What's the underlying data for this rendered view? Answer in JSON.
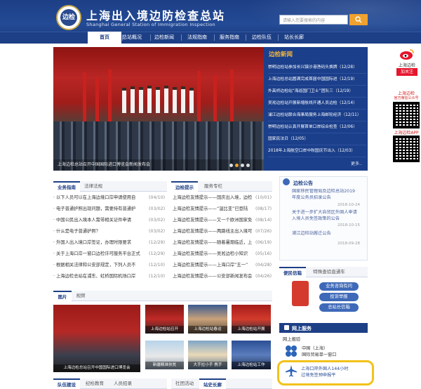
{
  "header": {
    "title": "上海出入境边防检查总站",
    "subtitle": "Shanghai General Station of Immigration Inspection",
    "search_placeholder": "请输入您要搜索的内容",
    "logo_text": "边检"
  },
  "nav": [
    "首页",
    "总站概况",
    "边检新闻",
    "法规指南",
    "服务指南",
    "边检队伍",
    "站长长廊"
  ],
  "slider": {
    "caption": "上海边检总站召开中国国际进口博览会新闻发布会",
    "dots": 4
  },
  "news": {
    "title": "边检新闻",
    "more": "更多..",
    "items": [
      {
        "text": "崇明边检站参加长兴镇沙港渔码头换牌",
        "date": "（12/28）"
      },
      {
        "text": "上海边检总站圆满完成首届中国国际进",
        "date": "（12/19）"
      },
      {
        "text": "外高桥边检站“海巡国门卫士”团队三",
        "date": "（12/19）"
      },
      {
        "text": "吴淞边检站开展新增航线开通人员边检",
        "date": "（12/14）"
      },
      {
        "text": "浦江边检站联合海事局服务上海邮轮经济",
        "date": "（12/11）"
      },
      {
        "text": "崇明边检站认真开展首单口岸综合检查",
        "date": "（12/06）"
      },
      {
        "text": "国家民法日（12/05）",
        "date": ""
      },
      {
        "text": "2018年上海航空口岸中秋国庆节出入",
        "date": "（12/03）"
      }
    ]
  },
  "right_rail": {
    "weibo_label": "上海边检",
    "follow": "加关注",
    "app_label1": "上海边检",
    "app_label2": "官方微信公众号",
    "app_label3": "上海边检APP"
  },
  "guide": {
    "tabs": [
      "业务指南",
      "法律法规"
    ],
    "items": [
      {
        "text": "· 以下人员可以在上海边境口岸申请使用自",
        "date": "(04/10)"
      },
      {
        "text": "· 电子普通护照出现问题，需要持有普通护",
        "date": "(03/02)"
      },
      {
        "text": "· 中国公民出入境本人需带相关证件申请",
        "date": "(03/02)"
      },
      {
        "text": "· 什么是电子普通护照？",
        "date": "(03/02)"
      },
      {
        "text": "· 外国人出入境口岸签证，办理时限要求",
        "date": "(12/29)"
      },
      {
        "text": "· 关于上海口岸一窗口边检许可服务平台正式",
        "date": "(12/29)"
      },
      {
        "text": "· 根据相关法律和公安部规定，下列人员不",
        "date": "(12/10)"
      },
      {
        "text": "· 上海边检总站在浦东、虹桥国际机场口岸",
        "date": "(12/10)"
      }
    ]
  },
  "tips": {
    "tabs": [
      "边检提示",
      "服务专栏"
    ],
    "items": [
      {
        "text": "上海边检友情提示——国庆出入境，边检",
        "date": "(10/01)"
      },
      {
        "text": "上海边检友情提示——“温比亚”已登陆",
        "date": "(08/17)"
      },
      {
        "text": "上海边检友情提示——又一个欧洲国家免",
        "date": "(08/14)"
      },
      {
        "text": "上海边检友情提示——两路线主出入境可",
        "date": "(07/26)"
      },
      {
        "text": "上海边检友情提示——随着暑期临近，上",
        "date": "(06/19)"
      },
      {
        "text": "上海边检友情提示——吴淞边检小知识",
        "date": "(05/16)"
      },
      {
        "text": "上海边检友情提示——上海口岸“五一”",
        "date": "(04/28)"
      },
      {
        "text": "上海边检友情提示——公安部新闻发布会",
        "date": "(04/26)"
      }
    ]
  },
  "notices": {
    "title": "边检公告",
    "items": [
      {
        "text1": "国家移民管理局及边检总站2019",
        "text2": "年度公务员招录公告",
        "date": "2018-10-24"
      },
      {
        "text1": "关于进一步扩大自贸区外国人申请",
        "text2": "入境人员免签政策的公告",
        "date": "2018-10-15"
      },
      {
        "text1": "浦江边检站搬迁公告",
        "text2": "",
        "date": "2018-09-28"
      }
    ]
  },
  "convenience": {
    "tabs": [
      "便民信箱",
      "特殊查验直通车"
    ],
    "buttons": [
      "业务咨询有问",
      "投诉举报",
      "总站长信箱"
    ]
  },
  "gallery": {
    "tabs": [
      "图片",
      "视频"
    ],
    "main_caption": "上海边检总站召开中国国际进口博览会",
    "thumbs": [
      "上海边检站召开",
      "上海边检站春运",
      "上海边检站开展",
      "新疆精准扶贫",
      "大手拉小手 携手",
      "上海边检站工作"
    ]
  },
  "online": {
    "title": "网上服务",
    "sub": "网上报验",
    "link1a": "中国（上海）",
    "link1b": "国际贸易单一窗口",
    "link2a": "上海口岸外国人144小时",
    "link2b": "过境免签预申报平"
  },
  "bottom_tabs": {
    "left": [
      "队伍建设",
      "纪检教育",
      "人员招录"
    ],
    "right": [
      "社团活动",
      "站史长廊"
    ]
  },
  "colors": {
    "primary": "#1d3f86",
    "accent": "#f0a22e",
    "highlight": "#f2c21a"
  }
}
